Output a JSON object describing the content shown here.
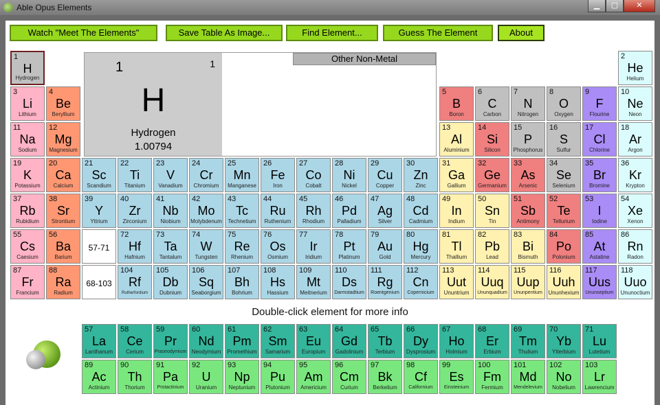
{
  "window": {
    "title": "Able Opus Elements",
    "min": "▁",
    "max": "▢",
    "close": "✕"
  },
  "toolbar": [
    {
      "label": "Watch \"Meet The Elements\"",
      "active": false
    },
    {
      "label": "Save Table As Image...",
      "active": false
    },
    {
      "label": "Find Element...",
      "active": false
    },
    {
      "label": "Guess The Element",
      "active": false
    },
    {
      "label": "About",
      "active": true
    }
  ],
  "detail": {
    "number": "1",
    "number_small": "1",
    "symbol": "H",
    "name": "Hydrogen",
    "weight": "1.00794",
    "category": "Other Non-Metal"
  },
  "hint": "Double-click element for more info",
  "colors": {
    "alkali": "#ffb3c6",
    "alkaline": "#ff9773",
    "transition": "#abd6e6",
    "post": "#fff1b0",
    "metalloid": "#f07f7f",
    "nonmetal": "#c0c0c0",
    "halogen": "#a98cf5",
    "noble": "#dafcfd",
    "lanthanide": "#33b69b",
    "actinide": "#7ae77e",
    "placeholder": "#ffffff"
  },
  "elements": [
    {
      "n": "1",
      "s": "H",
      "name": "Hydrogen",
      "r": 1,
      "c": 1,
      "t": "nonmetal"
    },
    {
      "n": "2",
      "s": "He",
      "name": "Helium",
      "r": 1,
      "c": 18,
      "t": "noble"
    },
    {
      "n": "3",
      "s": "Li",
      "name": "Lithium",
      "r": 2,
      "c": 1,
      "t": "alkali"
    },
    {
      "n": "4",
      "s": "Be",
      "name": "Beryllium",
      "r": 2,
      "c": 2,
      "t": "alkaline"
    },
    {
      "n": "5",
      "s": "B",
      "name": "Boron",
      "r": 2,
      "c": 13,
      "t": "metalloid"
    },
    {
      "n": "6",
      "s": "C",
      "name": "Carbon",
      "r": 2,
      "c": 14,
      "t": "nonmetal"
    },
    {
      "n": "7",
      "s": "N",
      "name": "Nitrogen",
      "r": 2,
      "c": 15,
      "t": "nonmetal"
    },
    {
      "n": "8",
      "s": "O",
      "name": "Oxygen",
      "r": 2,
      "c": 16,
      "t": "nonmetal"
    },
    {
      "n": "9",
      "s": "F",
      "name": "Flourine",
      "r": 2,
      "c": 17,
      "t": "halogen"
    },
    {
      "n": "10",
      "s": "Ne",
      "name": "Neon",
      "r": 2,
      "c": 18,
      "t": "noble"
    },
    {
      "n": "11",
      "s": "Na",
      "name": "Sodium",
      "r": 3,
      "c": 1,
      "t": "alkali"
    },
    {
      "n": "12",
      "s": "Mg",
      "name": "Magnesium",
      "r": 3,
      "c": 2,
      "t": "alkaline"
    },
    {
      "n": "13",
      "s": "Al",
      "name": "Aluminium",
      "r": 3,
      "c": 13,
      "t": "post"
    },
    {
      "n": "14",
      "s": "Si",
      "name": "Silicon",
      "r": 3,
      "c": 14,
      "t": "metalloid"
    },
    {
      "n": "15",
      "s": "P",
      "name": "Phosphorus",
      "r": 3,
      "c": 15,
      "t": "nonmetal"
    },
    {
      "n": "16",
      "s": "S",
      "name": "Sulfur",
      "r": 3,
      "c": 16,
      "t": "nonmetal"
    },
    {
      "n": "17",
      "s": "Cl",
      "name": "Chlorine",
      "r": 3,
      "c": 17,
      "t": "halogen"
    },
    {
      "n": "18",
      "s": "Ar",
      "name": "Argon",
      "r": 3,
      "c": 18,
      "t": "noble"
    },
    {
      "n": "19",
      "s": "K",
      "name": "Potassium",
      "r": 4,
      "c": 1,
      "t": "alkali"
    },
    {
      "n": "20",
      "s": "Ca",
      "name": "Calcium",
      "r": 4,
      "c": 2,
      "t": "alkaline"
    },
    {
      "n": "21",
      "s": "Sc",
      "name": "Scandium",
      "r": 4,
      "c": 3,
      "t": "transition"
    },
    {
      "n": "22",
      "s": "Ti",
      "name": "Titanium",
      "r": 4,
      "c": 4,
      "t": "transition"
    },
    {
      "n": "23",
      "s": "V",
      "name": "Vanadium",
      "r": 4,
      "c": 5,
      "t": "transition"
    },
    {
      "n": "24",
      "s": "Cr",
      "name": "Chromium",
      "r": 4,
      "c": 6,
      "t": "transition"
    },
    {
      "n": "25",
      "s": "Mn",
      "name": "Manganese",
      "r": 4,
      "c": 7,
      "t": "transition"
    },
    {
      "n": "26",
      "s": "Fe",
      "name": "Iron",
      "r": 4,
      "c": 8,
      "t": "transition"
    },
    {
      "n": "27",
      "s": "Co",
      "name": "Cobalt",
      "r": 4,
      "c": 9,
      "t": "transition"
    },
    {
      "n": "28",
      "s": "Ni",
      "name": "Nickel",
      "r": 4,
      "c": 10,
      "t": "transition"
    },
    {
      "n": "29",
      "s": "Cu",
      "name": "Copper",
      "r": 4,
      "c": 11,
      "t": "transition"
    },
    {
      "n": "30",
      "s": "Zn",
      "name": "Zinc",
      "r": 4,
      "c": 12,
      "t": "transition"
    },
    {
      "n": "31",
      "s": "Ga",
      "name": "Gallium",
      "r": 4,
      "c": 13,
      "t": "post"
    },
    {
      "n": "32",
      "s": "Ge",
      "name": "Germanium",
      "r": 4,
      "c": 14,
      "t": "metalloid"
    },
    {
      "n": "33",
      "s": "As",
      "name": "Arsenic",
      "r": 4,
      "c": 15,
      "t": "metalloid"
    },
    {
      "n": "34",
      "s": "Se",
      "name": "Selenium",
      "r": 4,
      "c": 16,
      "t": "nonmetal"
    },
    {
      "n": "35",
      "s": "Br",
      "name": "Bromine",
      "r": 4,
      "c": 17,
      "t": "halogen"
    },
    {
      "n": "36",
      "s": "Kr",
      "name": "Krypton",
      "r": 4,
      "c": 18,
      "t": "noble"
    },
    {
      "n": "37",
      "s": "Rb",
      "name": "Rubidium",
      "r": 5,
      "c": 1,
      "t": "alkali"
    },
    {
      "n": "38",
      "s": "Sr",
      "name": "Strontium",
      "r": 5,
      "c": 2,
      "t": "alkaline"
    },
    {
      "n": "39",
      "s": "Y",
      "name": "Yttrium",
      "r": 5,
      "c": 3,
      "t": "transition"
    },
    {
      "n": "40",
      "s": "Zr",
      "name": "Zirconium",
      "r": 5,
      "c": 4,
      "t": "transition"
    },
    {
      "n": "41",
      "s": "Nb",
      "name": "Niobium",
      "r": 5,
      "c": 5,
      "t": "transition"
    },
    {
      "n": "42",
      "s": "Mo",
      "name": "Molybdenum",
      "r": 5,
      "c": 6,
      "t": "transition"
    },
    {
      "n": "43",
      "s": "Tc",
      "name": "Technetium",
      "r": 5,
      "c": 7,
      "t": "transition"
    },
    {
      "n": "44",
      "s": "Ru",
      "name": "Ruthenium",
      "r": 5,
      "c": 8,
      "t": "transition"
    },
    {
      "n": "45",
      "s": "Rh",
      "name": "Rhodium",
      "r": 5,
      "c": 9,
      "t": "transition"
    },
    {
      "n": "46",
      "s": "Pd",
      "name": "Palladium",
      "r": 5,
      "c": 10,
      "t": "transition"
    },
    {
      "n": "47",
      "s": "Ag",
      "name": "Silver",
      "r": 5,
      "c": 11,
      "t": "transition"
    },
    {
      "n": "48",
      "s": "Cd",
      "name": "Cadmium",
      "r": 5,
      "c": 12,
      "t": "transition"
    },
    {
      "n": "49",
      "s": "In",
      "name": "Indium",
      "r": 5,
      "c": 13,
      "t": "post"
    },
    {
      "n": "50",
      "s": "Sn",
      "name": "Tin",
      "r": 5,
      "c": 14,
      "t": "post"
    },
    {
      "n": "51",
      "s": "Sb",
      "name": "Antimony",
      "r": 5,
      "c": 15,
      "t": "metalloid"
    },
    {
      "n": "52",
      "s": "Te",
      "name": "Tellurium",
      "r": 5,
      "c": 16,
      "t": "metalloid"
    },
    {
      "n": "53",
      "s": "I",
      "name": "Iodine",
      "r": 5,
      "c": 17,
      "t": "halogen"
    },
    {
      "n": "54",
      "s": "Xe",
      "name": "Xenon",
      "r": 5,
      "c": 18,
      "t": "noble"
    },
    {
      "n": "55",
      "s": "Cs",
      "name": "Caesium",
      "r": 6,
      "c": 1,
      "t": "alkali"
    },
    {
      "n": "56",
      "s": "Ba",
      "name": "Barium",
      "r": 6,
      "c": 2,
      "t": "alkaline"
    },
    {
      "n": "",
      "s": "57-71",
      "name": "",
      "r": 6,
      "c": 3,
      "t": "placeholder"
    },
    {
      "n": "72",
      "s": "Hf",
      "name": "Hafnium",
      "r": 6,
      "c": 4,
      "t": "transition"
    },
    {
      "n": "73",
      "s": "Ta",
      "name": "Tantalum",
      "r": 6,
      "c": 5,
      "t": "transition"
    },
    {
      "n": "74",
      "s": "W",
      "name": "Tungsten",
      "r": 6,
      "c": 6,
      "t": "transition"
    },
    {
      "n": "75",
      "s": "Re",
      "name": "Rhenium",
      "r": 6,
      "c": 7,
      "t": "transition"
    },
    {
      "n": "76",
      "s": "Os",
      "name": "Osmium",
      "r": 6,
      "c": 8,
      "t": "transition"
    },
    {
      "n": "77",
      "s": "Ir",
      "name": "Iridium",
      "r": 6,
      "c": 9,
      "t": "transition"
    },
    {
      "n": "78",
      "s": "Pt",
      "name": "Platinum",
      "r": 6,
      "c": 10,
      "t": "transition"
    },
    {
      "n": "79",
      "s": "Au",
      "name": "Gold",
      "r": 6,
      "c": 11,
      "t": "transition"
    },
    {
      "n": "80",
      "s": "Hg",
      "name": "Mercury",
      "r": 6,
      "c": 12,
      "t": "transition"
    },
    {
      "n": "81",
      "s": "Tl",
      "name": "Thallium",
      "r": 6,
      "c": 13,
      "t": "post"
    },
    {
      "n": "82",
      "s": "Pb",
      "name": "Lead",
      "r": 6,
      "c": 14,
      "t": "post"
    },
    {
      "n": "83",
      "s": "Bi",
      "name": "Bismuth",
      "r": 6,
      "c": 15,
      "t": "post"
    },
    {
      "n": "84",
      "s": "Po",
      "name": "Polonium",
      "r": 6,
      "c": 16,
      "t": "metalloid"
    },
    {
      "n": "85",
      "s": "At",
      "name": "Astatine",
      "r": 6,
      "c": 17,
      "t": "halogen"
    },
    {
      "n": "86",
      "s": "Rn",
      "name": "Radon",
      "r": 6,
      "c": 18,
      "t": "noble"
    },
    {
      "n": "87",
      "s": "Fr",
      "name": "Francium",
      "r": 7,
      "c": 1,
      "t": "alkali"
    },
    {
      "n": "88",
      "s": "Ra",
      "name": "Radium",
      "r": 7,
      "c": 2,
      "t": "alkaline"
    },
    {
      "n": "",
      "s": "68-103",
      "name": "",
      "r": 7,
      "c": 3,
      "t": "placeholder"
    },
    {
      "n": "104",
      "s": "Rf",
      "name": "Rutherfordium",
      "r": 7,
      "c": 4,
      "t": "transition"
    },
    {
      "n": "105",
      "s": "Db",
      "name": "Dubnium",
      "r": 7,
      "c": 5,
      "t": "transition"
    },
    {
      "n": "106",
      "s": "Sq",
      "name": "Seaborgium",
      "r": 7,
      "c": 6,
      "t": "transition"
    },
    {
      "n": "107",
      "s": "Bh",
      "name": "Bohrium",
      "r": 7,
      "c": 7,
      "t": "transition"
    },
    {
      "n": "108",
      "s": "Hs",
      "name": "Hassium",
      "r": 7,
      "c": 8,
      "t": "transition"
    },
    {
      "n": "109",
      "s": "Mt",
      "name": "Meitnerium",
      "r": 7,
      "c": 9,
      "t": "transition"
    },
    {
      "n": "110",
      "s": "Ds",
      "name": "Darmstadtium",
      "r": 7,
      "c": 10,
      "t": "transition"
    },
    {
      "n": "111",
      "s": "Rg",
      "name": "Roentgenium",
      "r": 7,
      "c": 11,
      "t": "transition"
    },
    {
      "n": "112",
      "s": "Cn",
      "name": "Copernicium",
      "r": 7,
      "c": 12,
      "t": "transition"
    },
    {
      "n": "113",
      "s": "Uut",
      "name": "Ununtrium",
      "r": 7,
      "c": 13,
      "t": "post"
    },
    {
      "n": "114",
      "s": "Uuq",
      "name": "Ununquadium",
      "r": 7,
      "c": 14,
      "t": "post"
    },
    {
      "n": "115",
      "s": "Uup",
      "name": "Ununpentium",
      "r": 7,
      "c": 15,
      "t": "post"
    },
    {
      "n": "116",
      "s": "Uuh",
      "name": "Ununhexium",
      "r": 7,
      "c": 16,
      "t": "post"
    },
    {
      "n": "117",
      "s": "Uus",
      "name": "Ununseptium",
      "r": 7,
      "c": 17,
      "t": "halogen"
    },
    {
      "n": "118",
      "s": "Uuo",
      "name": "Ununoctium",
      "r": 7,
      "c": 18,
      "t": "noble"
    },
    {
      "n": "57",
      "s": "La",
      "name": "Lanthanum",
      "r": 8,
      "c": 3,
      "t": "lanthanide"
    },
    {
      "n": "58",
      "s": "Ce",
      "name": "Cerium",
      "r": 8,
      "c": 4,
      "t": "lanthanide"
    },
    {
      "n": "59",
      "s": "Pr",
      "name": "Praseodymium",
      "r": 8,
      "c": 5,
      "t": "lanthanide"
    },
    {
      "n": "60",
      "s": "Nd",
      "name": "Neodymium",
      "r": 8,
      "c": 6,
      "t": "lanthanide"
    },
    {
      "n": "61",
      "s": "Pm",
      "name": "Promethium",
      "r": 8,
      "c": 7,
      "t": "lanthanide"
    },
    {
      "n": "62",
      "s": "Sm",
      "name": "Samarium",
      "r": 8,
      "c": 8,
      "t": "lanthanide"
    },
    {
      "n": "63",
      "s": "Eu",
      "name": "Europium",
      "r": 8,
      "c": 9,
      "t": "lanthanide"
    },
    {
      "n": "64",
      "s": "Gd",
      "name": "Gadolinium",
      "r": 8,
      "c": 10,
      "t": "lanthanide"
    },
    {
      "n": "65",
      "s": "Tb",
      "name": "Terbium",
      "r": 8,
      "c": 11,
      "t": "lanthanide"
    },
    {
      "n": "66",
      "s": "Dy",
      "name": "Dysprosium",
      "r": 8,
      "c": 12,
      "t": "lanthanide"
    },
    {
      "n": "67",
      "s": "Ho",
      "name": "Holmium",
      "r": 8,
      "c": 13,
      "t": "lanthanide"
    },
    {
      "n": "68",
      "s": "Er",
      "name": "Erbium",
      "r": 8,
      "c": 14,
      "t": "lanthanide"
    },
    {
      "n": "69",
      "s": "Tm",
      "name": "Thulium",
      "r": 8,
      "c": 15,
      "t": "lanthanide"
    },
    {
      "n": "70",
      "s": "Yb",
      "name": "Ytterbium",
      "r": 8,
      "c": 16,
      "t": "lanthanide"
    },
    {
      "n": "71",
      "s": "Lu",
      "name": "Lutetium",
      "r": 8,
      "c": 17,
      "t": "lanthanide"
    },
    {
      "n": "89",
      "s": "Ac",
      "name": "Actinium",
      "r": 9,
      "c": 3,
      "t": "actinide"
    },
    {
      "n": "90",
      "s": "Th",
      "name": "Thorium",
      "r": 9,
      "c": 4,
      "t": "actinide"
    },
    {
      "n": "91",
      "s": "Pa",
      "name": "Protactinium",
      "r": 9,
      "c": 5,
      "t": "actinide"
    },
    {
      "n": "92",
      "s": "U",
      "name": "Uranium",
      "r": 9,
      "c": 6,
      "t": "actinide"
    },
    {
      "n": "93",
      "s": "Np",
      "name": "Neptunium",
      "r": 9,
      "c": 7,
      "t": "actinide"
    },
    {
      "n": "94",
      "s": "Pu",
      "name": "Plutonium",
      "r": 9,
      "c": 8,
      "t": "actinide"
    },
    {
      "n": "95",
      "s": "Am",
      "name": "Americium",
      "r": 9,
      "c": 9,
      "t": "actinide"
    },
    {
      "n": "96",
      "s": "Cm",
      "name": "Curium",
      "r": 9,
      "c": 10,
      "t": "actinide"
    },
    {
      "n": "97",
      "s": "Bk",
      "name": "Berkelium",
      "r": 9,
      "c": 11,
      "t": "actinide"
    },
    {
      "n": "98",
      "s": "Cf",
      "name": "Californium",
      "r": 9,
      "c": 12,
      "t": "actinide"
    },
    {
      "n": "99",
      "s": "Es",
      "name": "Einsteinium",
      "r": 9,
      "c": 13,
      "t": "actinide"
    },
    {
      "n": "100",
      "s": "Fm",
      "name": "Fermium",
      "r": 9,
      "c": 14,
      "t": "actinide"
    },
    {
      "n": "101",
      "s": "Md",
      "name": "Mendelevium",
      "r": 9,
      "c": 15,
      "t": "actinide"
    },
    {
      "n": "102",
      "s": "No",
      "name": "Nobelium",
      "r": 9,
      "c": 16,
      "t": "actinide"
    },
    {
      "n": "103",
      "s": "Lr",
      "name": "Lawrencium",
      "r": 9,
      "c": 17,
      "t": "actinide"
    }
  ],
  "selected": "1"
}
